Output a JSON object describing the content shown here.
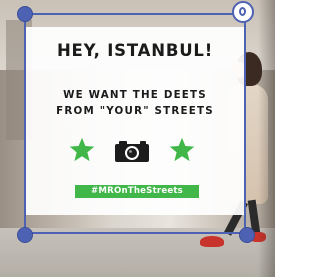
{
  "poster": {
    "headline": "HEY, ISTANBUL!",
    "subline_1": "WE WANT THE DEETS",
    "subline_2": "FROM \"YOUR\" STREETS",
    "hashtag": "#MROnTheStreets",
    "icons": [
      "star-icon",
      "camera-icon",
      "star-icon"
    ]
  },
  "colors": {
    "frame": "#4e62b3",
    "star": "#41b649",
    "hashtag_bg": "#41b649",
    "shoe": "#c8332b"
  }
}
